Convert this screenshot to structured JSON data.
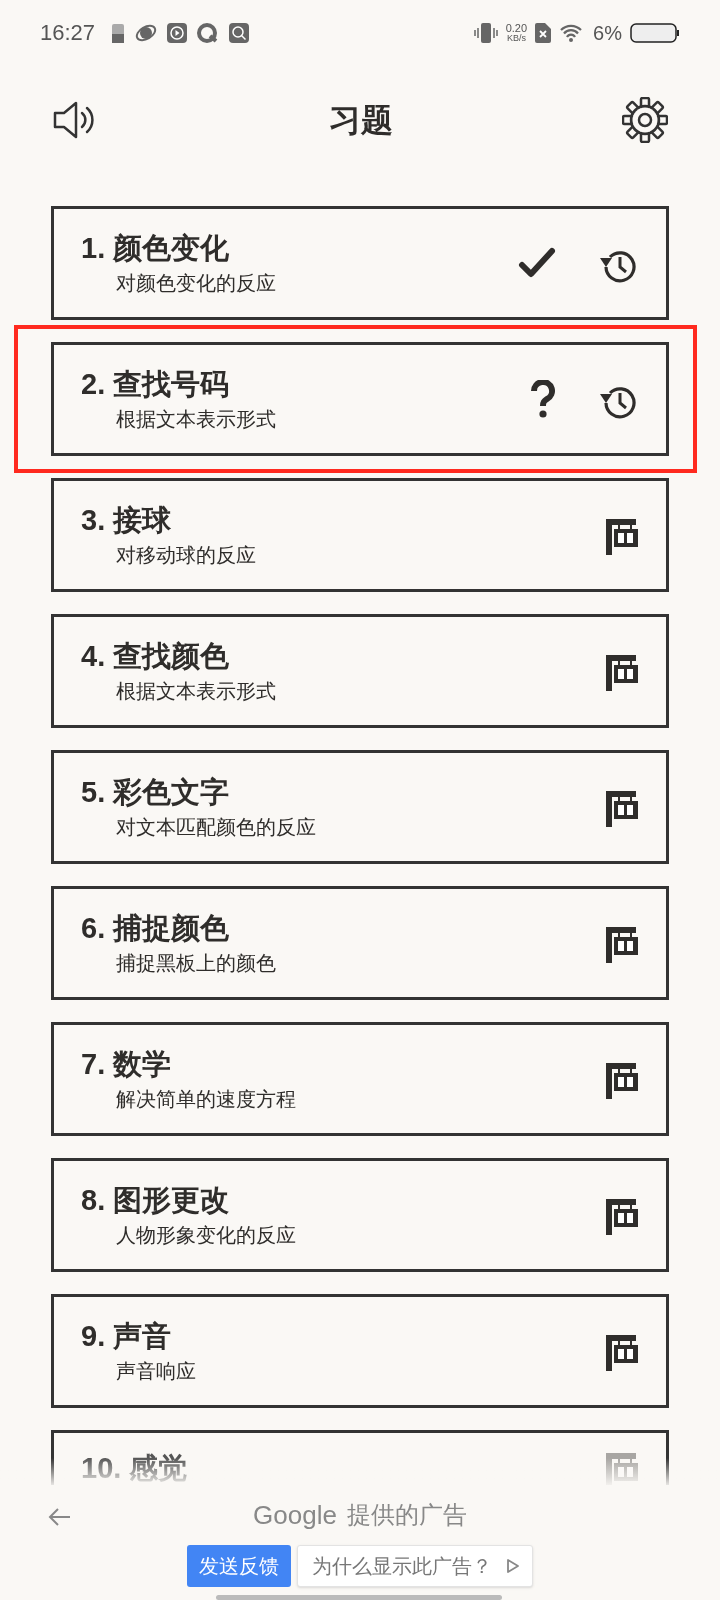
{
  "status_bar": {
    "time": "16:27",
    "net_speed": "0.20",
    "net_unit": "KB/s",
    "battery": "6%"
  },
  "header": {
    "title": "习题"
  },
  "exercises": [
    {
      "number": "1.",
      "title": "颜色变化",
      "subtitle": "对颜色变化的反应",
      "kind": "done",
      "highlighted": false
    },
    {
      "number": "2.",
      "title": "查找号码",
      "subtitle": "根据文本表示形式",
      "kind": "pending",
      "highlighted": true
    },
    {
      "number": "3.",
      "title": "接球",
      "subtitle": "对移动球的反应",
      "kind": "locked",
      "highlighted": false
    },
    {
      "number": "4.",
      "title": "查找颜色",
      "subtitle": "根据文本表示形式",
      "kind": "locked",
      "highlighted": false
    },
    {
      "number": "5.",
      "title": "彩色文字",
      "subtitle": "对文本匹配颜色的反应",
      "kind": "locked",
      "highlighted": false
    },
    {
      "number": "6.",
      "title": "捕捉颜色",
      "subtitle": "捕捉黑板上的颜色",
      "kind": "locked",
      "highlighted": false
    },
    {
      "number": "7.",
      "title": "数学",
      "subtitle": "解决简单的速度方程",
      "kind": "locked",
      "highlighted": false
    },
    {
      "number": "8.",
      "title": "图形更改",
      "subtitle": "人物形象变化的反应",
      "kind": "locked",
      "highlighted": false
    },
    {
      "number": "9.",
      "title": "声音",
      "subtitle": "声音响应",
      "kind": "locked",
      "highlighted": false
    },
    {
      "number": "10.",
      "title": "感觉",
      "kind": "locked",
      "highlighted": false
    }
  ],
  "ad_bar": {
    "brand": "Google",
    "label": "提供的广告",
    "feedback_button": "发送反馈",
    "why_button": "为什么显示此广告？"
  }
}
